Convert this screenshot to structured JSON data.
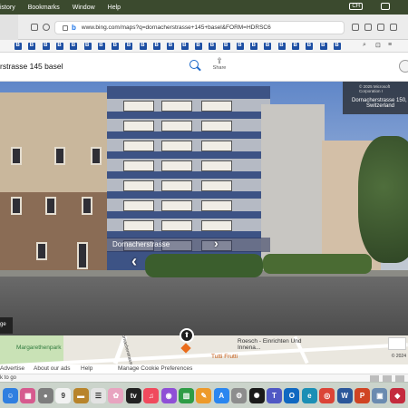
{
  "menubar": {
    "items": [
      "istory",
      "Bookmarks",
      "Window",
      "Help"
    ],
    "input_indicator": "CH"
  },
  "browser": {
    "url": "www.bing.com/maps?q=dornacherstrasse+145+basel&FORM=HDRSC6"
  },
  "bookmarks": {
    "count": 24,
    "color": "#1e4fa3",
    "trailing_icons": [
      "search-icon",
      "bookmark-icon",
      "menu-icon"
    ]
  },
  "search": {
    "query": "rstrasse 145 basel",
    "share_label": "Share"
  },
  "streetside": {
    "street_name": "Dornacherstrasse",
    "copyright": "© 2025 Microsoft Corporation I",
    "address_line1": "Dornacherstrasse 150, 40",
    "address_line2": "Switzerland",
    "map_toggle_label": "ge"
  },
  "minimap": {
    "labels": {
      "park": "Margarethenpark",
      "street_vertical": "Dornacherstrasse",
      "business": "Roesch - Einrichten Und Innena...",
      "poi": "Tutti Frutti"
    },
    "copyright": "© 2024"
  },
  "footer": {
    "links": [
      "Advertise",
      "About our ads",
      "Help",
      "Manage Cookie Preferences"
    ]
  },
  "status": {
    "text": "k to go"
  },
  "dock": {
    "icons": [
      {
        "name": "finder-icon",
        "glyph": "☺",
        "color": "#2f7fe0"
      },
      {
        "name": "launchpad-icon",
        "glyph": "▦",
        "color": "#d65a8e"
      },
      {
        "name": "system-icon",
        "glyph": "●",
        "color": "#7d7d7d"
      },
      {
        "name": "calendar-icon",
        "glyph": "9",
        "color": "#f2f2f2"
      },
      {
        "name": "notes-icon",
        "glyph": "▬",
        "color": "#b8842b"
      },
      {
        "name": "reminders-icon",
        "glyph": "☰",
        "color": "#e3e3e3"
      },
      {
        "name": "photos-icon",
        "glyph": "✿",
        "color": "#e8a4c0"
      },
      {
        "name": "appletv-icon",
        "glyph": "tv",
        "color": "#222222"
      },
      {
        "name": "music-icon",
        "glyph": "♫",
        "color": "#f04a5d"
      },
      {
        "name": "podcasts-icon",
        "glyph": "◉",
        "color": "#8f4fd6"
      },
      {
        "name": "numbers-icon",
        "glyph": "▥",
        "color": "#2e9c45"
      },
      {
        "name": "pages-icon",
        "glyph": "✎",
        "color": "#ed9a2a"
      },
      {
        "name": "appstore-icon",
        "glyph": "A",
        "color": "#2a86f0"
      },
      {
        "name": "settings-icon",
        "glyph": "⚙",
        "color": "#8d8d8d"
      },
      {
        "name": "chatgpt-icon",
        "glyph": "✺",
        "color": "#1a1a1a"
      },
      {
        "name": "teams-icon",
        "glyph": "T",
        "color": "#5058c4"
      },
      {
        "name": "outlook-icon",
        "glyph": "O",
        "color": "#1068c1"
      },
      {
        "name": "edge-icon",
        "glyph": "e",
        "color": "#1b8fb5"
      },
      {
        "name": "chrome-icon",
        "glyph": "◎",
        "color": "#db4437"
      },
      {
        "name": "word-icon",
        "glyph": "W",
        "color": "#2b579a"
      },
      {
        "name": "powerpoint-icon",
        "glyph": "P",
        "color": "#d04423"
      },
      {
        "name": "preview-icon",
        "glyph": "▣",
        "color": "#6a8bb0"
      },
      {
        "name": "app-icon",
        "glyph": "◆",
        "color": "#c42b3d"
      }
    ]
  }
}
